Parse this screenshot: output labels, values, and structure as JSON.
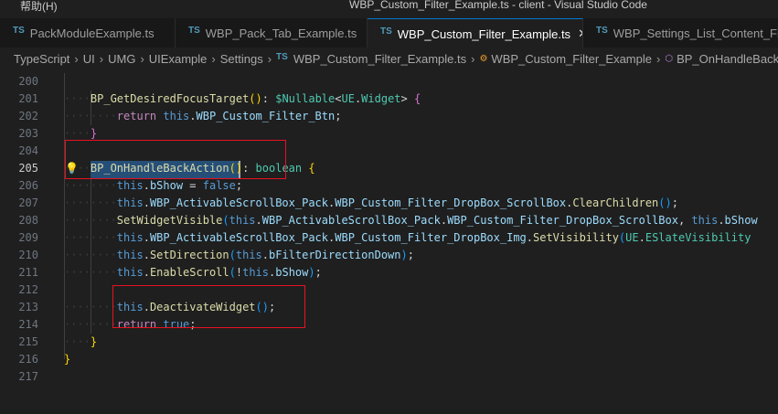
{
  "titlebar": {
    "menu_help": "帮助(H)",
    "title": "WBP_Custom_Filter_Example.ts - client - Visual Studio Code"
  },
  "tabs": [
    {
      "icon": "TS",
      "label": "PackModuleExample.ts"
    },
    {
      "icon": "TS",
      "label": "WBP_Pack_Tab_Example.ts"
    },
    {
      "icon": "TS",
      "label": "WBP_Custom_Filter_Example.ts",
      "close": "✕"
    },
    {
      "icon": "TS",
      "label": "WBP_Settings_List_Content_Filter"
    }
  ],
  "breadcrumb": [
    "TypeScript",
    "UI",
    "UMG",
    "UIExample",
    "Settings",
    "WBP_Custom_Filter_Example.ts",
    "WBP_Custom_Filter_Example",
    "BP_OnHandleBackAction"
  ],
  "breadcrumb_ts_icon": "TS",
  "current_line": 205,
  "lines": [
    {
      "n": "200",
      "t": []
    },
    {
      "n": "201",
      "t": [
        [
          "····",
          "ws"
        ],
        [
          "BP_GetDesiredFocusTarget",
          "fn"
        ],
        [
          "(",
          "b1"
        ],
        [
          ")",
          "b1"
        ],
        [
          ": ",
          "p"
        ],
        [
          "$Nullable",
          "ty"
        ],
        [
          "<",
          "p"
        ],
        [
          "UE",
          "ty"
        ],
        [
          ".",
          "p"
        ],
        [
          "Widget",
          "ty"
        ],
        [
          "> ",
          "p"
        ],
        [
          "{",
          "b2"
        ]
      ]
    },
    {
      "n": "202",
      "t": [
        [
          "········",
          "ws"
        ],
        [
          "return ",
          "kw"
        ],
        [
          "this",
          "th"
        ],
        [
          ".",
          "p"
        ],
        [
          "WBP_Custom_Filter_Btn",
          "pr"
        ],
        [
          ";",
          "p"
        ]
      ]
    },
    {
      "n": "203",
      "t": [
        [
          "····",
          "ws"
        ],
        [
          "}",
          "b2"
        ]
      ]
    },
    {
      "n": "204",
      "t": []
    },
    {
      "n": "205",
      "t": [
        [
          "····",
          "ws"
        ],
        [
          "BP_OnHandleBackAction",
          "fn"
        ],
        [
          "(",
          "b1"
        ],
        [
          ")",
          "b1"
        ],
        [
          ": ",
          "p"
        ],
        [
          "boolean ",
          "ty"
        ],
        [
          "{",
          "b1"
        ]
      ]
    },
    {
      "n": "206",
      "t": [
        [
          "········",
          "ws"
        ],
        [
          "this",
          "th"
        ],
        [
          ".",
          "p"
        ],
        [
          "bShow",
          "pr"
        ],
        [
          " = ",
          "p"
        ],
        [
          "false",
          "th"
        ],
        [
          ";",
          "p"
        ]
      ]
    },
    {
      "n": "207",
      "t": [
        [
          "········",
          "ws"
        ],
        [
          "this",
          "th"
        ],
        [
          ".",
          "p"
        ],
        [
          "WBP_ActivableScrollBox_Pack",
          "pr"
        ],
        [
          ".",
          "p"
        ],
        [
          "WBP_Custom_Filter_DropBox_ScrollBox",
          "pr"
        ],
        [
          ".",
          "p"
        ],
        [
          "ClearChildren",
          "fn"
        ],
        [
          "(",
          "b3"
        ],
        [
          ")",
          "b3"
        ],
        [
          ";",
          "p"
        ]
      ]
    },
    {
      "n": "208",
      "t": [
        [
          "········",
          "ws"
        ],
        [
          "SetWidgetVisible",
          "fn"
        ],
        [
          "(",
          "b3"
        ],
        [
          "this",
          "th"
        ],
        [
          ".",
          "p"
        ],
        [
          "WBP_ActivableScrollBox_Pack",
          "pr"
        ],
        [
          ".",
          "p"
        ],
        [
          "WBP_Custom_Filter_DropBox_ScrollBox",
          "pr"
        ],
        [
          ", ",
          "p"
        ],
        [
          "this",
          "th"
        ],
        [
          ".",
          "p"
        ],
        [
          "bShow",
          "pr"
        ]
      ]
    },
    {
      "n": "209",
      "t": [
        [
          "········",
          "ws"
        ],
        [
          "this",
          "th"
        ],
        [
          ".",
          "p"
        ],
        [
          "WBP_ActivableScrollBox_Pack",
          "pr"
        ],
        [
          ".",
          "p"
        ],
        [
          "WBP_Custom_Filter_DropBox_Img",
          "pr"
        ],
        [
          ".",
          "p"
        ],
        [
          "SetVisibility",
          "fn"
        ],
        [
          "(",
          "b3"
        ],
        [
          "UE",
          "ty"
        ],
        [
          ".",
          "p"
        ],
        [
          "ESlateVisibility",
          "ty"
        ]
      ]
    },
    {
      "n": "210",
      "t": [
        [
          "········",
          "ws"
        ],
        [
          "this",
          "th"
        ],
        [
          ".",
          "p"
        ],
        [
          "SetDirection",
          "fn"
        ],
        [
          "(",
          "b3"
        ],
        [
          "this",
          "th"
        ],
        [
          ".",
          "p"
        ],
        [
          "bFilterDirectionDown",
          "pr"
        ],
        [
          ")",
          "b3"
        ],
        [
          ";",
          "p"
        ]
      ]
    },
    {
      "n": "211",
      "t": [
        [
          "········",
          "ws"
        ],
        [
          "this",
          "th"
        ],
        [
          ".",
          "p"
        ],
        [
          "EnableScroll",
          "fn"
        ],
        [
          "(",
          "b3"
        ],
        [
          "!",
          "p"
        ],
        [
          "this",
          "th"
        ],
        [
          ".",
          "p"
        ],
        [
          "bShow",
          "pr"
        ],
        [
          ")",
          "b3"
        ],
        [
          ";",
          "p"
        ]
      ]
    },
    {
      "n": "212",
      "t": []
    },
    {
      "n": "213",
      "t": [
        [
          "········",
          "ws"
        ],
        [
          "this",
          "th"
        ],
        [
          ".",
          "p"
        ],
        [
          "DeactivateWidget",
          "fn"
        ],
        [
          "(",
          "b3"
        ],
        [
          ")",
          "b3"
        ],
        [
          ";",
          "p"
        ]
      ]
    },
    {
      "n": "214",
      "t": [
        [
          "········",
          "ws"
        ],
        [
          "return ",
          "kw"
        ],
        [
          "true",
          "th"
        ],
        [
          ";",
          "p"
        ]
      ]
    },
    {
      "n": "215",
      "t": [
        [
          "····",
          "ws"
        ],
        [
          "}",
          "b1"
        ]
      ]
    },
    {
      "n": "216",
      "t": [
        [
          "}",
          "b1"
        ]
      ]
    },
    {
      "n": "217",
      "t": []
    }
  ]
}
